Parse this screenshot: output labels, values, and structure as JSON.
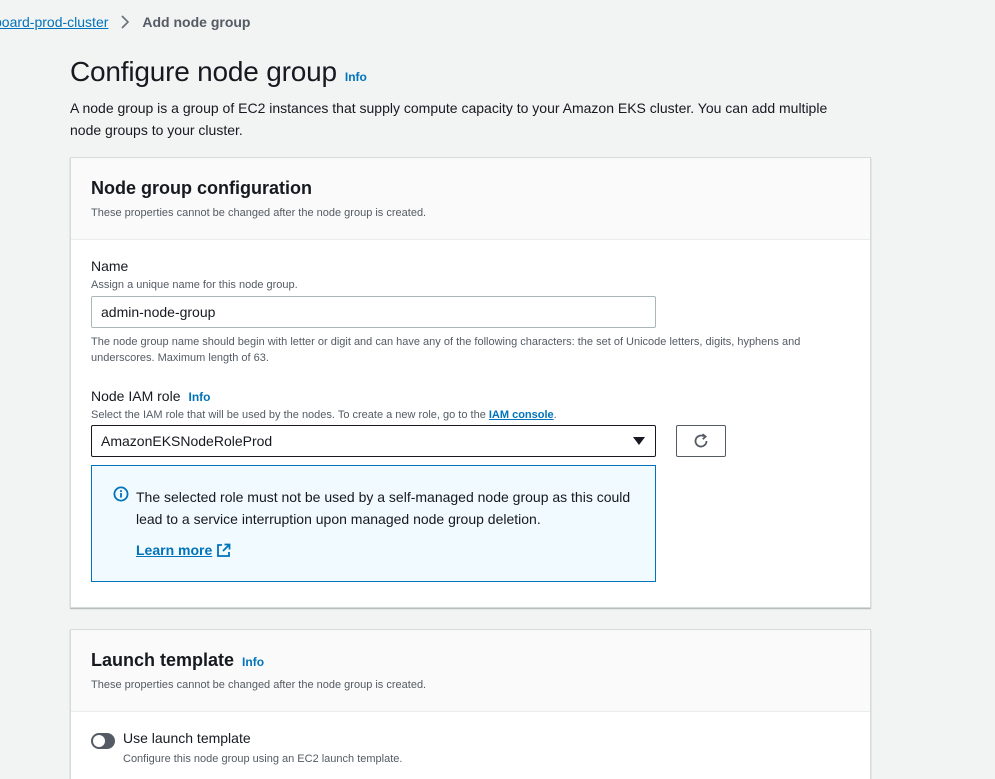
{
  "breadcrumb": {
    "cluster_link": "board-prod-cluster",
    "current": "Add node group"
  },
  "header": {
    "title": "Configure node group",
    "info": "Info",
    "description": "A node group is a group of EC2 instances that supply compute capacity to your Amazon EKS cluster. You can add multiple node groups to your cluster."
  },
  "node_group_config": {
    "title": "Node group configuration",
    "description": "These properties cannot be changed after the node group is created.",
    "name_field": {
      "label": "Name",
      "description": "Assign a unique name for this node group.",
      "value": "admin-node-group",
      "constraint": "The node group name should begin with letter or digit and can have any of the following characters: the set of Unicode letters, digits, hyphens and underscores. Maximum length of 63."
    },
    "iam_role_field": {
      "label": "Node IAM role",
      "info": "Info",
      "description_prefix": "Select the IAM role that will be used by the nodes. To create a new role, go to the ",
      "description_link": "IAM console",
      "description_suffix": ".",
      "selected_value": "AmazonEKSNodeRoleProd",
      "refresh_icon": "refresh-icon"
    },
    "alert": {
      "icon": "info-circle-icon",
      "text": "The selected role must not be used by a self-managed node group as this could lead to a service interruption upon managed node group deletion.",
      "link": "Learn more",
      "link_icon": "external-link-icon"
    }
  },
  "launch_template": {
    "title": "Launch template",
    "info": "Info",
    "description": "These properties cannot be changed after the node group is created.",
    "toggle_label": "Use launch template",
    "toggle_desc": "Configure this node group using an EC2 launch template.",
    "toggle_on": false
  },
  "colors": {
    "link": "#0073bb",
    "alert_bg": "#f1faff",
    "page_bg": "#f2f3f3"
  }
}
